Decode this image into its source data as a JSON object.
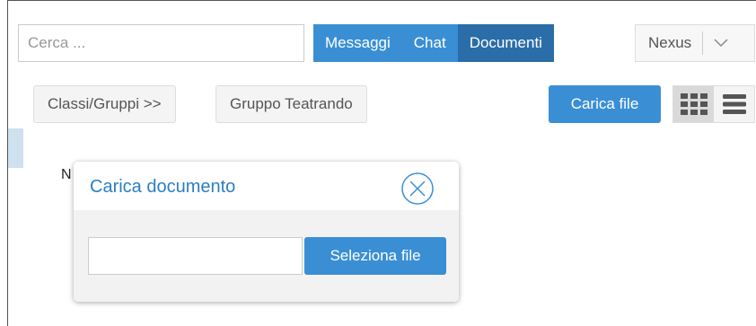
{
  "search": {
    "placeholder": "Cerca ..."
  },
  "tabs": [
    {
      "label": "Messaggi",
      "active": false
    },
    {
      "label": "Chat",
      "active": false
    },
    {
      "label": "Documenti",
      "active": true
    }
  ],
  "account": {
    "label": "Nexus",
    "icon": "chevron-down-icon"
  },
  "breadcrumbs": [
    {
      "label": "Classi/Gruppi >>"
    },
    {
      "label": "Gruppo Teatrando"
    }
  ],
  "toolbar": {
    "upload_label": "Carica file",
    "view_grid_icon": "grid-view-icon",
    "view_list_icon": "list-view-icon"
  },
  "background": {
    "partial_text": "N"
  },
  "modal": {
    "title": "Carica documento",
    "close_icon": "close-circle-icon",
    "file_value": "",
    "select_label": "Seleziona file"
  },
  "colors": {
    "primary": "#3a8fd4",
    "primary_active": "#2a6da8",
    "modal_title": "#2a7fc4"
  }
}
